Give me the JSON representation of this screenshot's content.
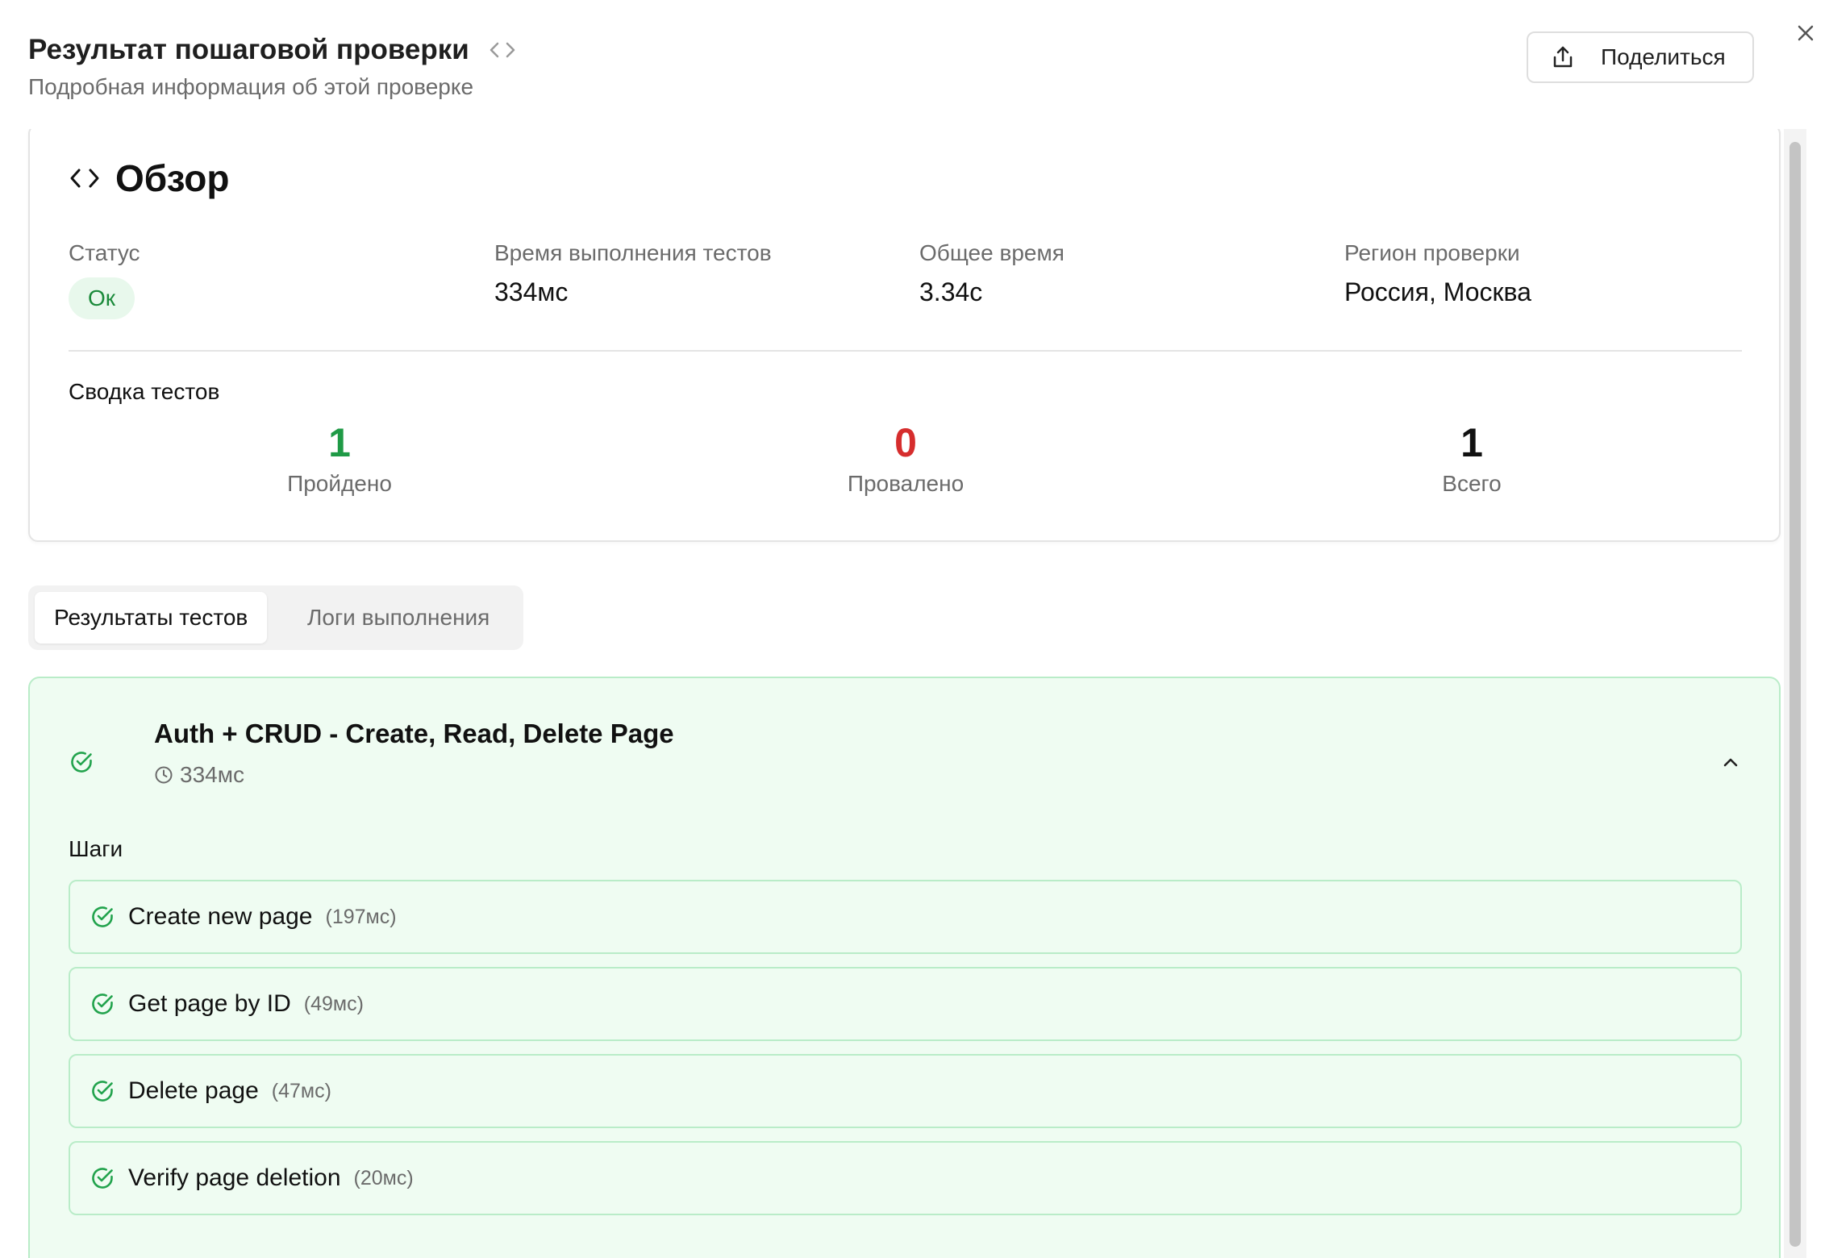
{
  "header": {
    "title": "Результат пошаговой проверки",
    "subtitle": "Подробная информация об этой проверке",
    "share_label": "Поделиться"
  },
  "overview": {
    "title": "Обзор",
    "status_label": "Статус",
    "status_value": "Ок",
    "test_time_label": "Время выполнения тестов",
    "test_time_value": "334мс",
    "total_time_label": "Общее время",
    "total_time_value": "3.34с",
    "region_label": "Регион проверки",
    "region_value": "Россия, Москва",
    "summary_title": "Сводка тестов",
    "stats": [
      {
        "value": "1",
        "label": "Пройдено",
        "color": "#1f9a46"
      },
      {
        "value": "0",
        "label": "Провалено",
        "color": "#d62d2d"
      },
      {
        "value": "1",
        "label": "Всего",
        "color": "#111111"
      }
    ]
  },
  "tabs": [
    {
      "label": "Результаты тестов",
      "active": true
    },
    {
      "label": "Логи выполнения",
      "active": false
    }
  ],
  "test": {
    "name": "Auth + CRUD - Create, Read, Delete Page",
    "duration": "334мс",
    "steps_title": "Шаги",
    "steps": [
      {
        "name": "Create new page",
        "time": "(197мс)"
      },
      {
        "name": "Get page by ID",
        "time": "(49мс)"
      },
      {
        "name": "Delete page",
        "time": "(47мс)"
      },
      {
        "name": "Verify page deletion",
        "time": "(20мс)"
      }
    ]
  },
  "colors": {
    "success": "#1f9a46",
    "fail": "#d62d2d",
    "success_bg": "#effcf2",
    "success_border": "#b9ecc8"
  },
  "icons": [
    "code-icon",
    "share-icon",
    "close-icon",
    "check-circle-icon",
    "clock-icon",
    "chevron-up-icon"
  ]
}
